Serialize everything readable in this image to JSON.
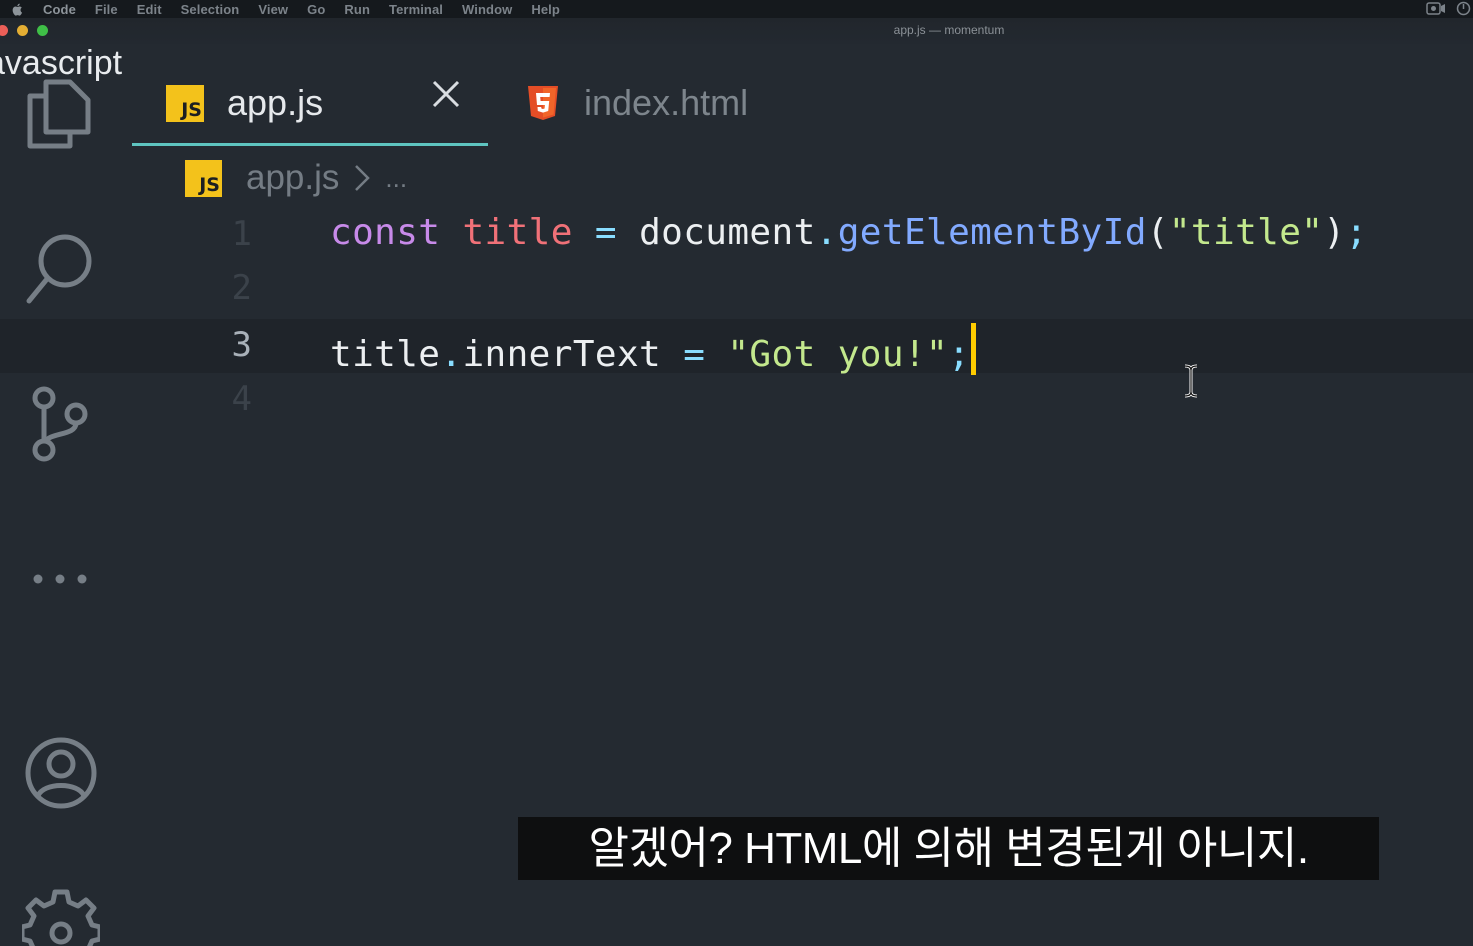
{
  "menubar": {
    "app_name": "Code",
    "items": [
      "File",
      "Edit",
      "Selection",
      "View",
      "Go",
      "Run",
      "Terminal",
      "Window",
      "Help"
    ]
  },
  "window": {
    "title": "app.js — momentum",
    "colors": {
      "close": "#ec5f58",
      "minimize": "#e4ae33",
      "zoom": "#3fbf47"
    }
  },
  "overlay": {
    "text": "avascript"
  },
  "activity_bar": {
    "icons": [
      "explorer-icon",
      "search-icon",
      "source-control-icon",
      "more-icon",
      "account-icon",
      "settings-icon"
    ]
  },
  "tabs": [
    {
      "label": "app.js",
      "badge": "JS",
      "active": true
    },
    {
      "label": "index.html",
      "badge": "5",
      "active": false
    }
  ],
  "breadcrumb": {
    "file": "app.js",
    "badge": "JS",
    "separator": ">",
    "more": "..."
  },
  "editor": {
    "lines": [
      {
        "number": "1"
      },
      {
        "number": "2"
      },
      {
        "number": "3"
      },
      {
        "number": "4"
      }
    ],
    "line1": {
      "kw": "const",
      "var": "title",
      "eq": "=",
      "obj": "document",
      "dot": ".",
      "fn": "getElementById",
      "paren_open": "(",
      "str": "\"title\"",
      "paren_close": ")",
      "semi": ";"
    },
    "line3": {
      "obj": "title",
      "dot": ".",
      "prop": "innerText",
      "eq": "=",
      "str": "\"Got you!\"",
      "semi": ";"
    }
  },
  "subtitle": {
    "text": "알겠어? HTML에 의해 변경된게 아니지."
  }
}
